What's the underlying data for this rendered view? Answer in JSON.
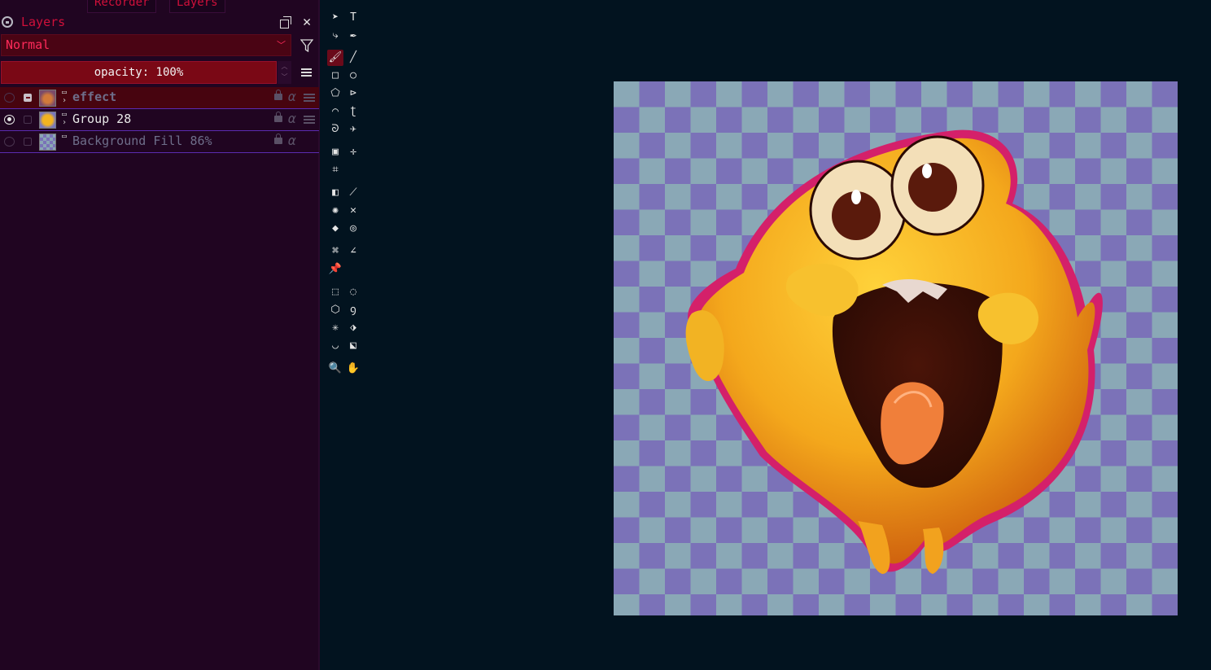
{
  "tabs": {
    "recorder": "Recorder",
    "layers": "Layers"
  },
  "panel": {
    "title": "Layers"
  },
  "blend_mode": "Normal",
  "opacity": {
    "label": "opacity: 100%"
  },
  "layers": [
    {
      "name": "effect"
    },
    {
      "name": "Group 28"
    },
    {
      "name": "Background Fill 86%"
    }
  ],
  "colors": {
    "accent": "#d0103a",
    "selected_layer_bg": "#47040f",
    "opacity_bg": "#7a0815",
    "canvas_bg": "#02131f",
    "checker_a": "#7b72b8",
    "checker_b": "#8aa8b6"
  },
  "tools": [
    "select-icon",
    "text-icon",
    "edit-shapes-icon",
    "calligraphy-icon",
    "freehand-brush-icon",
    "line-icon",
    "rectangle-icon",
    "ellipse-icon",
    "polygon-icon",
    "polyline-icon",
    "bezier-curve-icon",
    "bezier-freehand-icon",
    "freehand-path-icon",
    "dynamic-brush-icon",
    "transform-icon",
    "move-icon",
    "crop-icon",
    "gradient-icon",
    "color-sampler-icon",
    "smart-patch-icon",
    "assistant-icon",
    "fill-icon",
    "enclose-fill-icon",
    "reference-icon",
    "measure-icon",
    "pin-icon",
    "rect-select-icon",
    "ellipse-select-icon",
    "polygon-select-icon",
    "outline-select-icon",
    "contiguous-select-icon",
    "similar-select-icon",
    "bezier-select-icon",
    "magnetic-select-icon",
    "zoom-icon",
    "pan-icon"
  ]
}
